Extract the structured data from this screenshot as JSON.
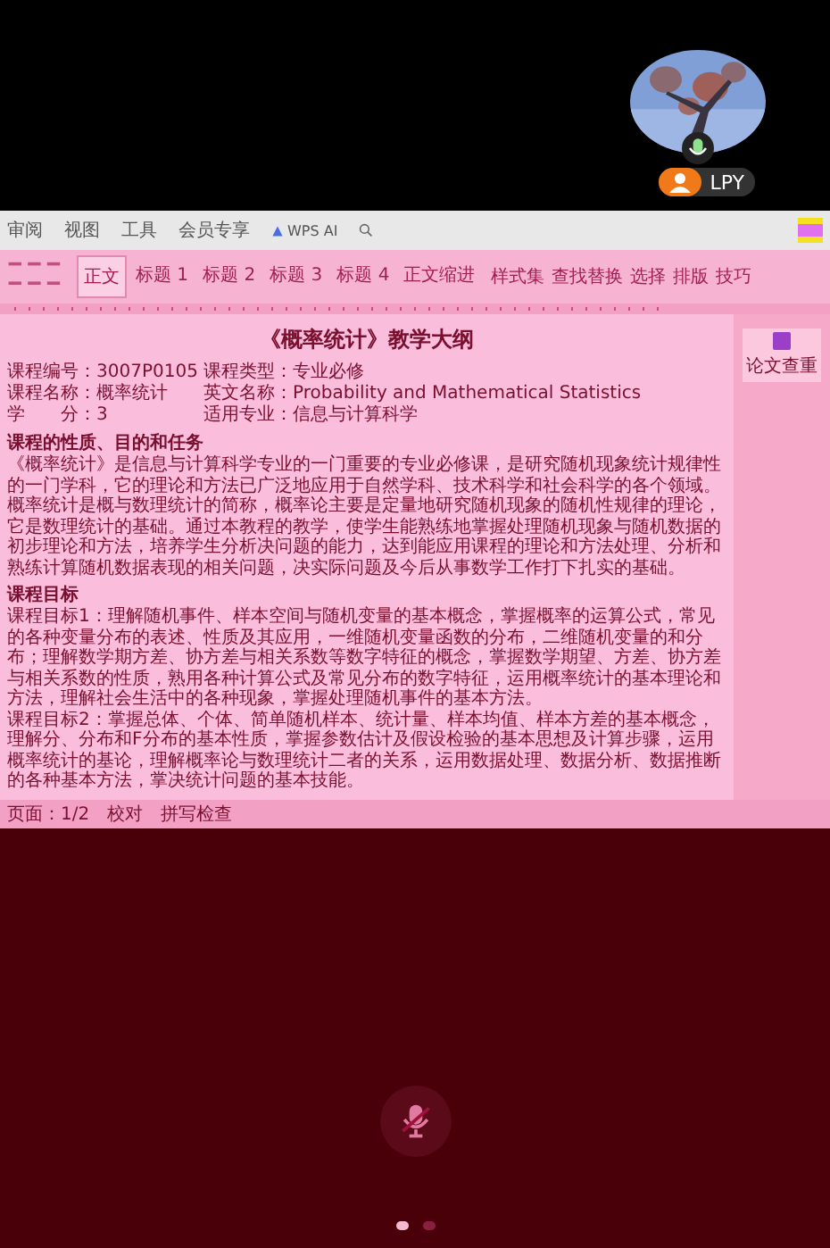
{
  "participant": {
    "name": "LPY",
    "speaking": true
  },
  "menu": {
    "tabs": [
      "审阅",
      "视图",
      "工具",
      "会员专享"
    ],
    "ai_label": "WPS AI"
  },
  "ribbon": {
    "styles": [
      {
        "label": "正文",
        "selected": true
      },
      {
        "label": "标题 1",
        "selected": false
      },
      {
        "label": "标题 2",
        "selected": false
      },
      {
        "label": "标题 3",
        "selected": false
      },
      {
        "label": "标题 4",
        "selected": false
      },
      {
        "label": "正文缩进",
        "selected": false
      }
    ],
    "tools": [
      "样式集",
      "查找替换",
      "选择",
      "排版",
      "技巧"
    ]
  },
  "side_panel": {
    "button": "论文查重"
  },
  "document": {
    "title": "《概率统计》教学大纲",
    "info": [
      {
        "left": "课程编号：3007P0105",
        "right": "课程类型：专业必修"
      },
      {
        "left": "课程名称：概率统计",
        "right": "英文名称：Probability and Mathematical Statistics"
      },
      {
        "left": "学　　分：3",
        "right": "适用专业：信息与计算科学"
      }
    ],
    "sections": [
      {
        "heading": "课程的性质、目的和任务",
        "paragraphs": [
          "《概率统计》是信息与计算科学专业的一门重要的专业必修课，是研究随机现象统计规律性的一门学科，它的理论和方法已广泛地应用于自然学科、技术科学和社会科学的各个领域。概率统计是概与数理统计的简称，概率论主要是定量地研究随机现象的随机性规律的理论，它是数理统计的基础。通过本教程的教学，使学生能熟练地掌握处理随机现象与随机数据的初步理论和方法，培养学生分析决问题的能力，达到能应用课程的理论和方法处理、分析和熟练计算随机数据表现的相关问题，决实际问题及今后从事数学工作打下扎实的基础。"
        ]
      },
      {
        "heading": "课程目标",
        "paragraphs": [
          "课程目标1：理解随机事件、样本空间与随机变量的基本概念，掌握概率的运算公式，常见的各种变量分布的表述、性质及其应用，一维随机变量函数的分布，二维随机变量的和分布；理解数学期方差、协方差与相关系数等数字特征的概念，掌握数学期望、方差、协方差与相关系数的性质，熟用各种计算公式及常见分布的数字特征，运用概率统计的基本理论和方法，理解社会生活中的各种现象，掌握处理随机事件的基本方法。",
          "课程目标2：掌握总体、个体、简单随机样本、统计量、样本均值、样本方差的基本概念，理解分、分布和F分布的基本性质，掌握参数估计及假设检验的基本思想及计算步骤，运用概率统计的基论，理解概率论与数理统计二者的关系，运用数据处理、数据分析、数据推断的各种基本方法，掌决统计问题的基本技能。"
        ]
      }
    ]
  },
  "status_bar": {
    "items": [
      "页面：1/2",
      "校对",
      "拼写检查"
    ]
  },
  "call": {
    "mic_muted": true,
    "pages": [
      {
        "selected": true
      },
      {
        "selected": false
      }
    ]
  }
}
